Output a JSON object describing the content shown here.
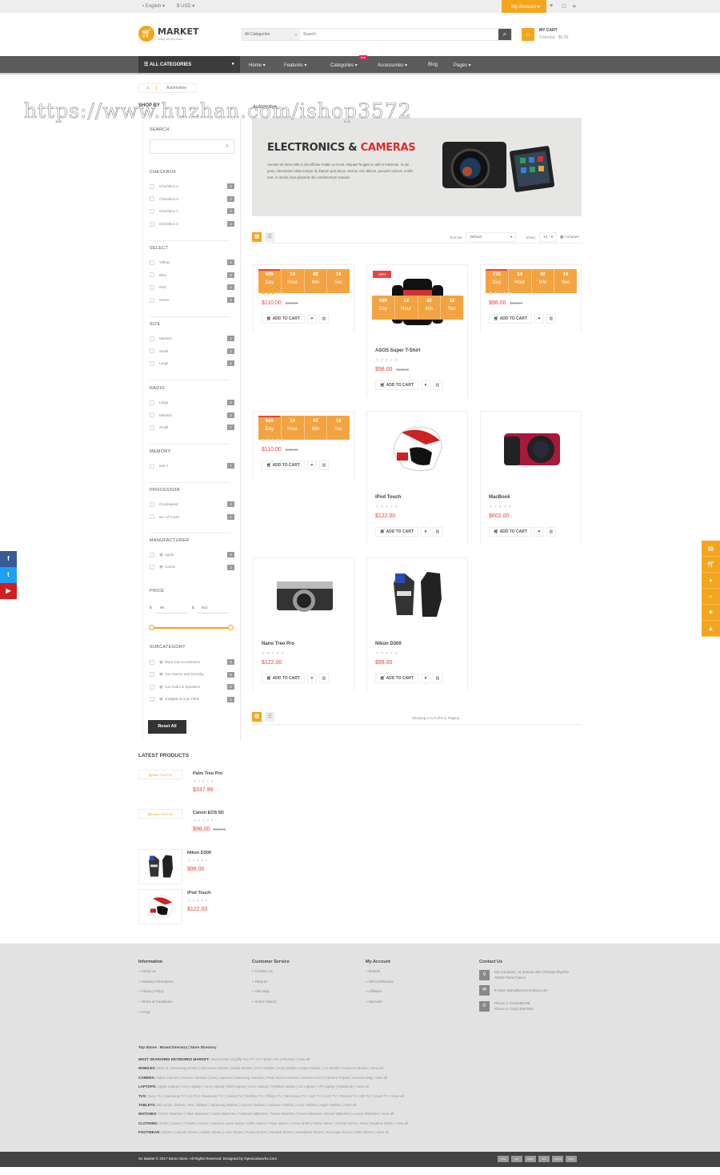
{
  "topbar": {
    "language": "English",
    "currency": "$ USD",
    "my_account": "My Account"
  },
  "header": {
    "logo_title": "MARKET",
    "logo_tagline": "Shop all you want",
    "search_category": "All Categories",
    "search_placeholder": "Search",
    "cart_title": "MY CART",
    "cart_summary": "0 item(s) - $0.00"
  },
  "nav": {
    "all_categories": "ALL CATEGORIES",
    "items": [
      "Home",
      "Features",
      "Categories",
      "Accessories",
      "Blog",
      "Pages"
    ],
    "hot_badge": "hot"
  },
  "breadcrumb": {
    "current": "Automotive"
  },
  "watermark": "https://www.huzhan.com/ishop3572",
  "sidebar": {
    "title": "SHOP BY",
    "search_label": "SEARCH",
    "sections": [
      {
        "title": "CHECKBOX",
        "options": [
          [
            "Checkbox 2",
            "2"
          ],
          [
            "Checkbox 3",
            "2"
          ],
          [
            "Checkbox 1",
            "2"
          ],
          [
            "Checkbox 4",
            "2"
          ]
        ]
      },
      {
        "title": "SELECT",
        "options": [
          [
            "Yellow",
            "2"
          ],
          [
            "Blue",
            "4"
          ],
          [
            "Red",
            "4"
          ],
          [
            "Green",
            "2"
          ]
        ]
      },
      {
        "title": "SIZE",
        "options": [
          [
            "Medium",
            "1"
          ],
          [
            "Small",
            "1"
          ],
          [
            "Large",
            "1"
          ]
        ]
      },
      {
        "title": "RADIO",
        "options": [
          [
            "Large",
            "2"
          ],
          [
            "Medium",
            "2"
          ],
          [
            "Small",
            "2"
          ]
        ]
      },
      {
        "title": "MEMORY",
        "options": [
          [
            "test 1",
            "1"
          ]
        ]
      },
      {
        "title": "PROCESSOR",
        "options": [
          [
            "Clockspeed",
            "2"
          ],
          [
            "No. of Cores",
            "1"
          ]
        ]
      },
      {
        "title": "MANUFACTURER",
        "options": [
          [
            "Apple",
            "4"
          ],
          [
            "Canon",
            "2"
          ]
        ]
      }
    ],
    "price": {
      "title": "PRICE",
      "currency": "$",
      "min": "98",
      "max": "602",
      "range": [
        98,
        602
      ]
    },
    "subcategory": {
      "title": "SUBCATEGORY",
      "options": [
        [
          "More Car Accessories",
          "3"
        ],
        [
          "Car Alarms and Security",
          "5"
        ],
        [
          "Car Audio & Speakers",
          "6"
        ],
        [
          "Gadgets & Auto Parts",
          "6"
        ]
      ]
    },
    "reset": "Reset All"
  },
  "main": {
    "title": "Automotive",
    "banner": {
      "heading_1": "ELECTRONICS &",
      "heading_2": "CAMERAS",
      "text": "Aenean sit amet nibh in dui efficitur mattis ut et est. Aliquam feugiat ut velit in maximus. In dui justo, elementum vitae tempor id, ibarum quis lacus. Sed ac nisl ultrices, posuere urna et, mollis erat. In iaculis risus placerat dui condimentum suscipit."
    },
    "toolbar": {
      "sort_label": "Sort By:",
      "sort_value": "Default",
      "show_label": "Show:",
      "show_value": "12",
      "compare": "Compare"
    },
    "add_to_cart": "ADD TO CART",
    "products": [
      {
        "name": "",
        "price": "$110.00",
        "old_price": "$122.00",
        "rating": 3,
        "countdown": [
          "699",
          "14",
          "42",
          "16"
        ],
        "layout": "compact",
        "image": "camera"
      },
      {
        "name": "ASOS Super T-Shirt",
        "price": "$98.00",
        "old_price": "$122.00",
        "rating": 0,
        "badge": "-20%",
        "countdown": [
          "699",
          "14",
          "42",
          "16"
        ],
        "layout": "full",
        "image": "jacket"
      },
      {
        "name": "",
        "price": "$98.00",
        "old_price": "$122.00",
        "rating": 0,
        "countdown": [
          "730",
          "14",
          "42",
          "16"
        ],
        "layout": "compact",
        "image": "camera"
      },
      {
        "name": "",
        "price": "$110.00",
        "old_price": "$122.00",
        "rating": 0,
        "countdown": [
          "669",
          "14",
          "42",
          "16"
        ],
        "layout": "compact",
        "image": "camera"
      },
      {
        "name": "iPod Touch",
        "price": "$122.00",
        "rating": 0,
        "layout": "full",
        "image": "helmet"
      },
      {
        "name": "MacBook",
        "price": "$602.00",
        "rating": 0,
        "layout": "full",
        "image": "red-camera"
      },
      {
        "name": "Nano Treo Pro",
        "price": "$122.00",
        "rating": 0,
        "layout": "full",
        "image": "retro-camera"
      },
      {
        "name": "Nikon D300",
        "price": "$98.00",
        "rating": 0,
        "layout": "full",
        "image": "gloves"
      }
    ],
    "countdown_labels": [
      "Day",
      "Hour",
      "Min",
      "Sec"
    ],
    "pagination_text": "Showing 1 to 8 of 8 (1 Pages)"
  },
  "latest": {
    "title": "LATEST PRODUCTS",
    "items": [
      {
        "name": "Palm Treo Pro",
        "price": "$337.99",
        "alt": "Palm Treo Pro",
        "image": "broken"
      },
      {
        "name": "Canon EOS 5D",
        "price": "$98.00",
        "old_price": "$122.00",
        "alt": "Canon EOS 5D",
        "image": "broken"
      },
      {
        "name": "Nikon D300",
        "price": "$98.00",
        "image": "gloves"
      },
      {
        "name": "iPod Touch",
        "price": "$122.00",
        "image": "helmet"
      }
    ]
  },
  "footer": {
    "columns": [
      {
        "title": "Information",
        "links": [
          "About Us",
          "Delivery Information",
          "Privacy Policy",
          "Terms & Conditions",
          "FAQs"
        ]
      },
      {
        "title": "Customer Service",
        "links": [
          "Contact Us",
          "Returns",
          "Site Map",
          "Order History"
        ]
      },
      {
        "title": "My Account",
        "links": [
          "Brands",
          "Gift Certificates",
          "Affiliates",
          "Specials"
        ]
      }
    ],
    "contact": {
      "title": "Contact Us",
      "address": "My Company, 42 avenue des Champs Elysées 75000 Paris France",
      "email": "E-mail: sales@yourcompany.com",
      "phone1": "Phone 1: 0123456789",
      "phone2": "Phone 2: (123) 4567890"
    },
    "stores_line": "Top Stores : Brand Directory | Store Directory",
    "keywords": [
      {
        "label": "MOST SEARCHED KEYWORDS MARKET:",
        "text": "Xiaomi Mi3 | Digiflip Pro XT 712 Tablet | Mi 3 Phones | View all"
      },
      {
        "label": "MOBILES:",
        "text": "Moto E | Samsung Mobile | Micromax Mobile | Nokia Mobile | HTC Mobile | Sony Mobile | Apple Mobile | LG Mobile | Karbonn Mobile | View all"
      },
      {
        "label": "CAMERA:",
        "text": "Nikon Camera | Canon Camera | Sony Camera | Samsung Camera | Point shoot camera | Camera Lens | Camera Tripod | Camera Bag | View all"
      },
      {
        "label": "LAPTOPS:",
        "text": "Apple Laptop | Acer Laptop | Sony Laptop | Dell Laptop | Asus Laptop | Toshiba Laptop | LG Laptop | HP Laptop | Notebook | View all"
      },
      {
        "label": "TVS:",
        "text": "Sony TV | Samsung TV | LG TV | Panasonic TV | Onida TV | Toshiba TV | Philips TV | Micromax TV | LED TV | LCD TV | Plasma TV | 3D TV | Smart TV | View all"
      },
      {
        "label": "TABLETS:",
        "text": "Micromax Tablets | HCL Tablets | Samsung Tablets | Lenovo Tablets | Karbonn Tablets | Asus Tablets | Apple Tablets | View all"
      },
      {
        "label": "WATCHES:",
        "text": "FCUK Watches | Titan Watches | Casio Watches | Fastrack Watches | Timex Watches | Fossil Watches | Diesel Watches | Luxury Watches | View all"
      },
      {
        "label": "CLOTHING:",
        "text": "Shirts | Jeans | T-shirts | Kurtis | Sarees | Levis Jeans | Killer Jeans | Pepe Jeans | Arrow Shirts | Ethnic Wear | Formal Shirts | Peter England Shirts | View all"
      },
      {
        "label": "FOOTWEAR:",
        "text": "Shoes | Casual Shoes | Adidas Shoes | Gas Shoes | Puma Shoes | Reebok Shoes | Woodland Shoes | Red tape Shoes | Nike Shoes | View all"
      }
    ],
    "copyright": "So Market © 2017 Demo Store. All Rights Reserved. Designed by Opencartworks.Com",
    "payments": [
      "VISA",
      "MC",
      "AMEX",
      "MC",
      "PayPal",
      "DISC"
    ]
  },
  "social": [
    {
      "icon": "facebook-icon",
      "glyph": "f",
      "color": "#3b5998"
    },
    {
      "icon": "twitter-icon",
      "glyph": "t",
      "color": "#1da1f2"
    },
    {
      "icon": "youtube-icon",
      "glyph": "▶",
      "color": "#cd201f"
    }
  ],
  "right_tools": [
    "categories-icon",
    "cart-icon",
    "account-icon",
    "search-icon",
    "star-icon",
    "top-icon"
  ],
  "colors": {
    "accent": "#f4a51c",
    "price": "#e8453c",
    "nav": "#5b5b5b"
  }
}
